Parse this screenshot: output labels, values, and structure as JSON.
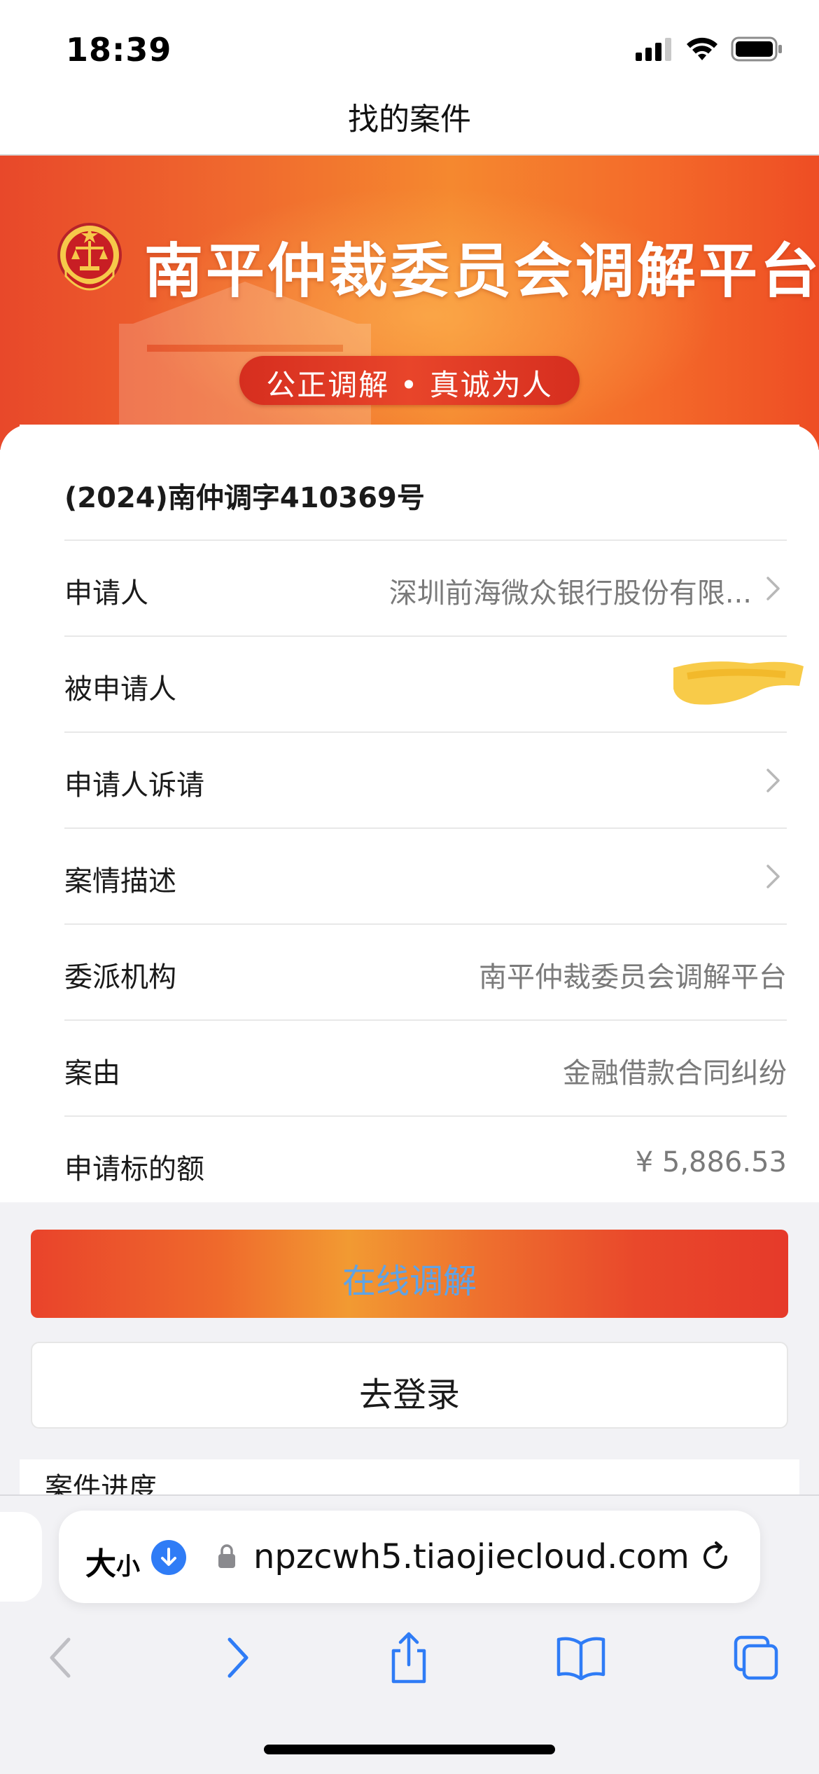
{
  "status_bar": {
    "time": "18:39"
  },
  "nav": {
    "title": "找的案件"
  },
  "banner": {
    "title": "南平仲裁委员会调解平台",
    "slogan": "公正调解 • 真诚为人"
  },
  "case": {
    "number": "(2024)南仲调字410369号",
    "rows": [
      {
        "label": "申请人",
        "value": "深圳前海微众银行股份有限..."
      },
      {
        "label": "被申请人",
        "value": ""
      },
      {
        "label": "申请人诉请",
        "value": ""
      },
      {
        "label": "案情描述",
        "value": ""
      },
      {
        "label": "委派机构",
        "value": "南平仲裁委员会调解平台"
      },
      {
        "label": "案由",
        "value": "金融借款合同纠纷"
      },
      {
        "label": "申请标的额",
        "value": "¥ 5,886.53"
      }
    ]
  },
  "actions": {
    "mediate_label": "在线调解",
    "login_label": "去登录"
  },
  "progress": {
    "title": "案件进度"
  },
  "browser": {
    "text_size_label": "大",
    "text_size_small": "小",
    "url": "npzcwh5.tiaojiecloud.com"
  },
  "colors": {
    "banner_red": "#e8482a",
    "banner_orange": "#f5882f",
    "mediate_text": "#5fa3e6",
    "ios_blue": "#2f7cf6"
  }
}
